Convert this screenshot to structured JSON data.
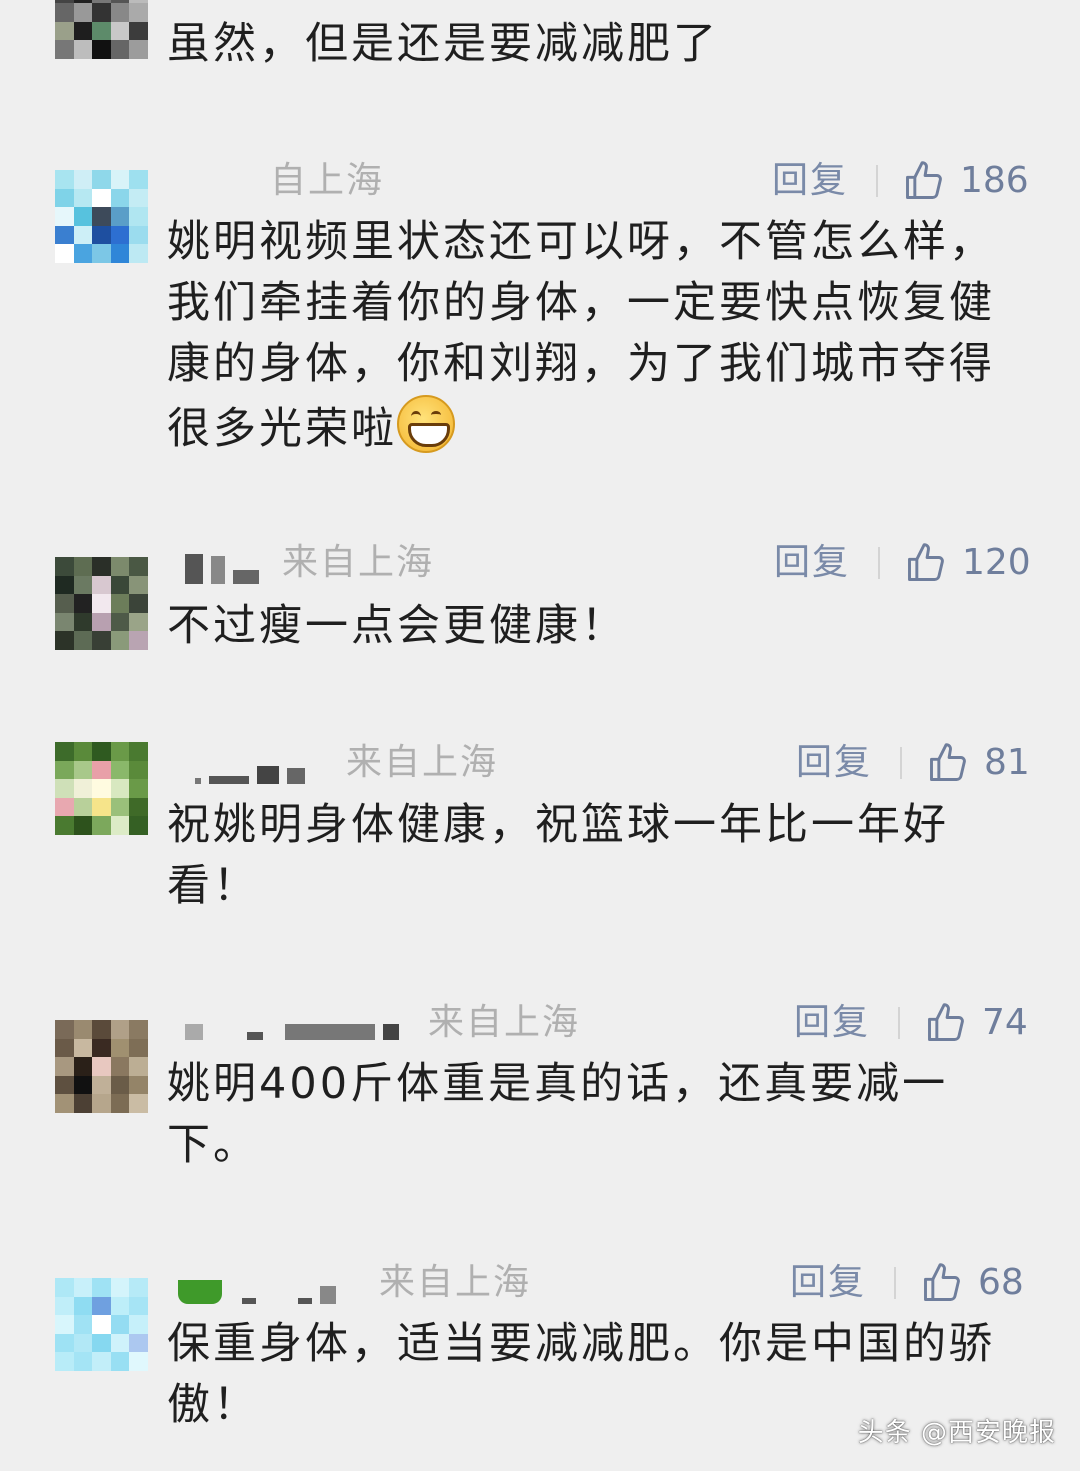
{
  "comments": [
    {
      "text": "虽然，但是还是要减减肥了"
    },
    {
      "origin": "自上海",
      "reply": "回复",
      "likes": "186",
      "text": "姚明视频里状态还可以呀，不管怎么样，我们牵挂着你的身体，一定要快点恢复健康的身体，你和刘翔，为了我们城市夺得很多光荣啦"
    },
    {
      "origin": "来自上海",
      "reply": "回复",
      "likes": "120",
      "text": "不过瘦一点会更健康！"
    },
    {
      "origin": "来自上海",
      "reply": "回复",
      "likes": "81",
      "text": "祝姚明身体健康，祝篮球一年比一年好看！"
    },
    {
      "origin": "来自上海",
      "reply": "回复",
      "likes": "74",
      "text": "姚明400斤体重是真的话，还真要减一下。"
    },
    {
      "origin": "来自上海",
      "reply": "回复",
      "likes": "68",
      "text": "保重身体，适当要减减肥。你是中国的骄傲！"
    }
  ],
  "icons": {
    "like": "thumbs-up-icon",
    "emoji": "grinning-face-emoji"
  },
  "colors": {
    "background": "#efefef",
    "reply": "#7a8aa8",
    "origin": "#b0b0b0"
  },
  "watermark": "头条 @西安晚报"
}
